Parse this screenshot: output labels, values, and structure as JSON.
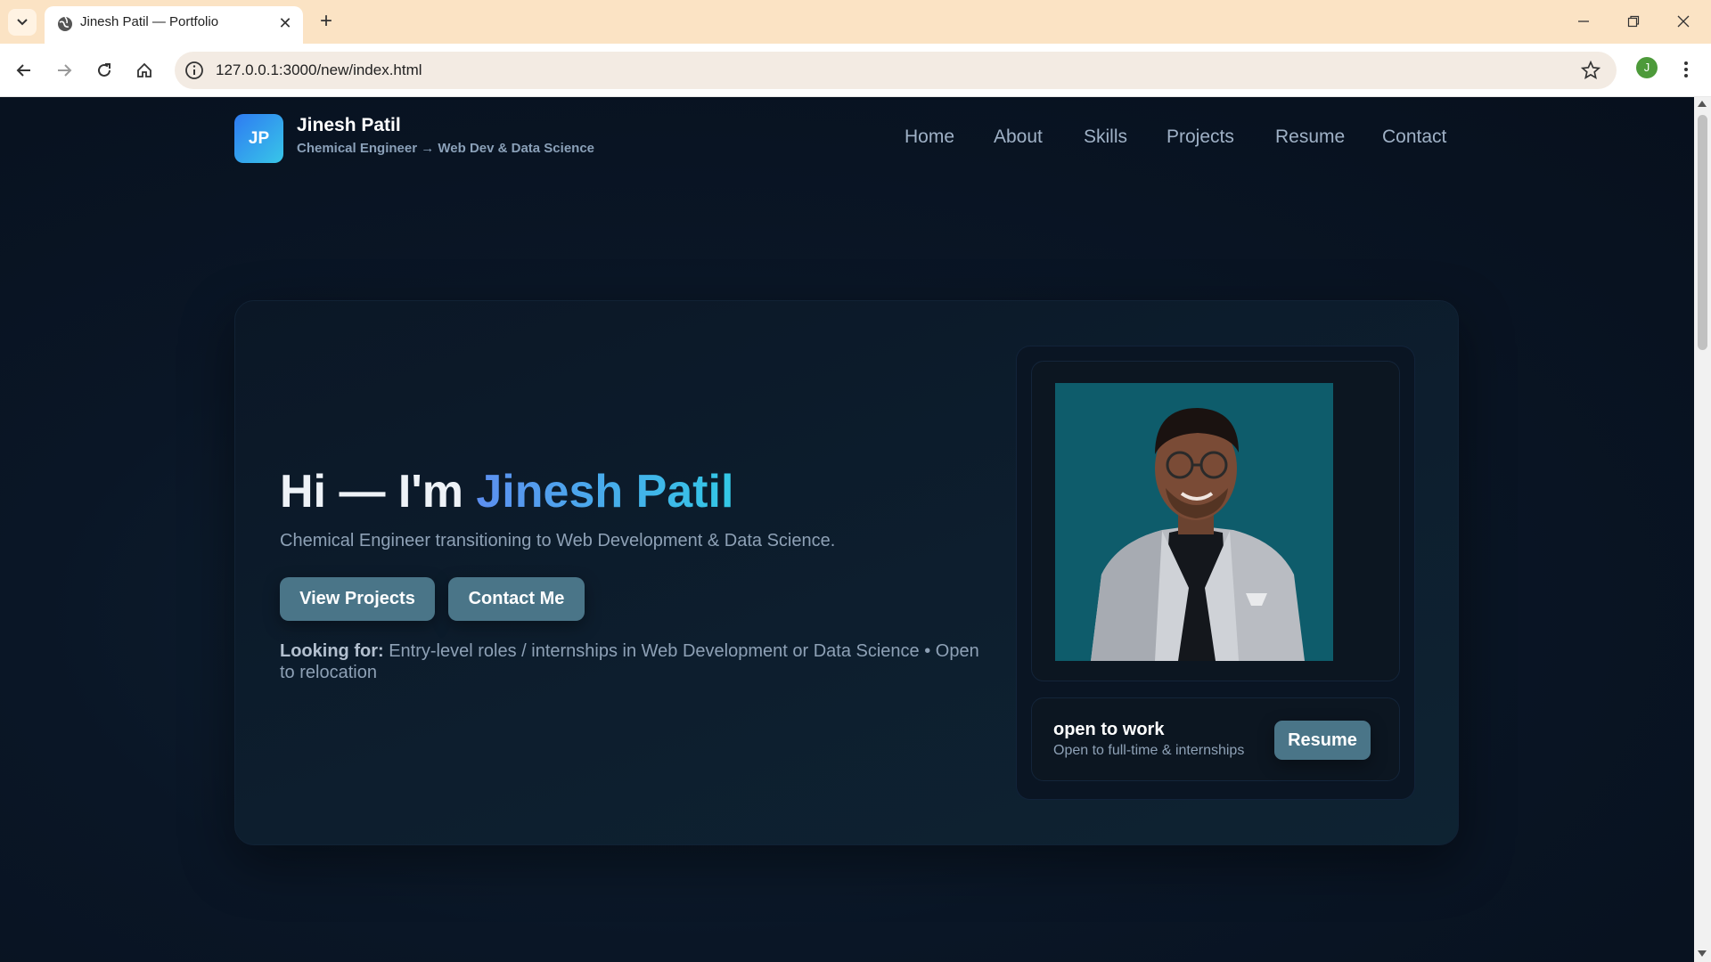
{
  "browser": {
    "tab_title": "Jinesh Patil — Portfolio",
    "url": "127.0.0.1:3000/new/index.html",
    "profile_initial": "J",
    "new_tab_symbol": "+",
    "close_symbol": "✕"
  },
  "site": {
    "logo_initials": "JP",
    "brand_name": "Jinesh Patil",
    "brand_tagline": "Chemical Engineer → Web Dev & Data Science",
    "nav": [
      "Home",
      "About",
      "Skills",
      "Projects",
      "Resume",
      "Contact"
    ]
  },
  "hero": {
    "title_prefix": "Hi — I'm ",
    "title_name": "Jinesh Patil",
    "subtitle": "Chemical Engineer transitioning to Web Development & Data Science.",
    "buttons": [
      "View Projects",
      "Contact Me"
    ],
    "looking_label": "Looking for:",
    "looking_text": " Entry-level roles / internships in Web Development or Data Science • Open to relocation"
  },
  "profile": {
    "status_title": "open to work",
    "status_sub": "Open to full-time & internships",
    "resume_button": "Resume"
  },
  "colors": {
    "accent_gradient_start": "#5d8ff0",
    "accent_gradient_end": "#33c8e6",
    "button_bg": "#4a7588",
    "page_bg": "#0a1626",
    "photo_bg": "#0e5c6b"
  },
  "icons": {
    "tab_list": "chevron-down-icon",
    "favicon": "globe-icon",
    "back": "arrow-left-icon",
    "forward": "arrow-right-icon",
    "reload": "reload-icon",
    "home": "home-icon",
    "site_info": "info-icon",
    "bookmark": "star-icon",
    "menu": "kebab-icon"
  }
}
